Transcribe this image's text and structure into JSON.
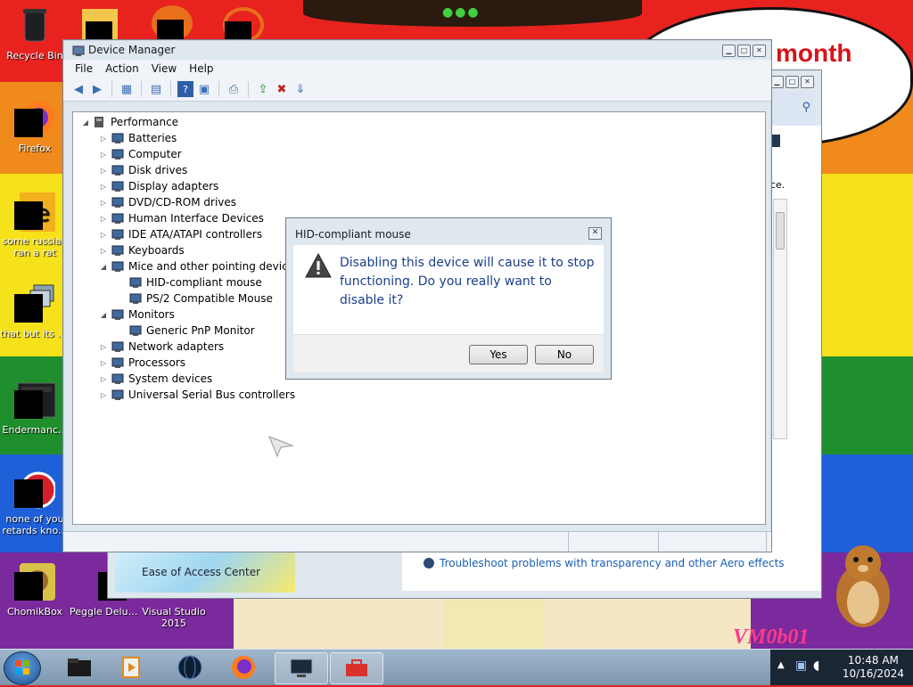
{
  "wallpaper": {
    "bubble_text": "month",
    "signature": "VM0b01"
  },
  "desktop_icons": [
    {
      "name": "recycle-bin",
      "label": "Recycle Bin"
    },
    {
      "name": "firefox",
      "label": "Firefox"
    },
    {
      "name": "some-russian",
      "label": "some russian ran a rat"
    },
    {
      "name": "that-but-its",
      "label": "that but its c..."
    },
    {
      "name": "endermanch",
      "label": "Endermanc..."
    },
    {
      "name": "none-of-you",
      "label": "none of you retards kno..."
    },
    {
      "name": "chomikbox",
      "label": "ChomikBox"
    },
    {
      "name": "peggle-deluxe",
      "label": "Peggle Deluxe"
    },
    {
      "name": "visual-studio",
      "label": "Visual Studio 2015"
    }
  ],
  "device_manager": {
    "title": "Device Manager",
    "menu": [
      "File",
      "Action",
      "View",
      "Help"
    ],
    "root": "Performance",
    "tree": [
      {
        "label": "Batteries",
        "expanded": false,
        "depth": 1
      },
      {
        "label": "Computer",
        "expanded": false,
        "depth": 1
      },
      {
        "label": "Disk drives",
        "expanded": false,
        "depth": 1
      },
      {
        "label": "Display adapters",
        "expanded": false,
        "depth": 1
      },
      {
        "label": "DVD/CD-ROM drives",
        "expanded": false,
        "depth": 1
      },
      {
        "label": "Human Interface Devices",
        "expanded": false,
        "depth": 1
      },
      {
        "label": "IDE ATA/ATAPI controllers",
        "expanded": false,
        "depth": 1
      },
      {
        "label": "Keyboards",
        "expanded": false,
        "depth": 1
      },
      {
        "label": "Mice and other pointing devices",
        "expanded": true,
        "depth": 1
      },
      {
        "label": "HID-compliant mouse",
        "depth": 2
      },
      {
        "label": "PS/2 Compatible Mouse",
        "depth": 2
      },
      {
        "label": "Monitors",
        "expanded": true,
        "depth": 1
      },
      {
        "label": "Generic PnP Monitor",
        "depth": 2
      },
      {
        "label": "Network adapters",
        "expanded": false,
        "depth": 1
      },
      {
        "label": "Processors",
        "expanded": false,
        "depth": 1
      },
      {
        "label": "System devices",
        "expanded": false,
        "depth": 1
      },
      {
        "label": "Universal Serial Bus controllers",
        "expanded": false,
        "depth": 1
      }
    ]
  },
  "dialog": {
    "title": "HID-compliant mouse",
    "message": "Disabling this device will cause it to stop functioning. Do you really want to disable it?",
    "yes_label": "Yes",
    "no_label": "No"
  },
  "back_window": {
    "partial_text": "nce.",
    "banner_label": "Ease of Access Center",
    "link_text": "Troubleshoot problems with transparency and other Aero effects"
  },
  "taskbar": {
    "time": "10:48 AM",
    "date": "10/16/2024"
  },
  "colors": {
    "link": "#1a5fb4",
    "dialog_text": "#1a3f8a"
  }
}
